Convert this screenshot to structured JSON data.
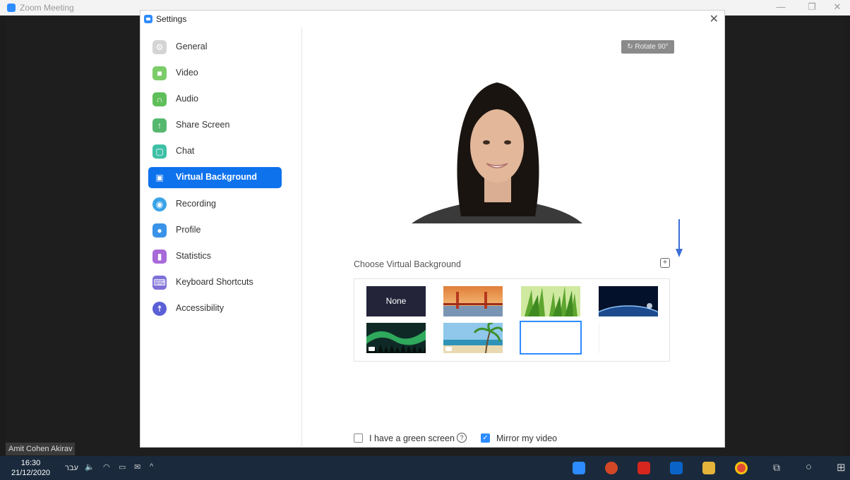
{
  "zoom_window": {
    "title": "Zoom Meeting",
    "participant_name": "Amit Cohen Akirav"
  },
  "settings": {
    "title": "Settings",
    "nav": [
      {
        "label": "General",
        "icon": "gear-icon",
        "color": "#d0d0d0"
      },
      {
        "label": "Video",
        "icon": "video-icon",
        "color": "#7ccc6a"
      },
      {
        "label": "Audio",
        "icon": "headphones-icon",
        "color": "#5fbf5a"
      },
      {
        "label": "Share Screen",
        "icon": "share-screen-icon",
        "color": "#55b86e"
      },
      {
        "label": "Chat",
        "icon": "chat-icon",
        "color": "#3ec0a6"
      },
      {
        "label": "Virtual Background",
        "icon": "person-card-icon",
        "color": "#0e72ed",
        "active": true
      },
      {
        "label": "Recording",
        "icon": "record-icon",
        "color": "#3aa3e8"
      },
      {
        "label": "Profile",
        "icon": "profile-icon",
        "color": "#3a93e8"
      },
      {
        "label": "Statistics",
        "icon": "bar-chart-icon",
        "color": "#a869d9"
      },
      {
        "label": "Keyboard Shortcuts",
        "icon": "keyboard-icon",
        "color": "#7e71d8"
      },
      {
        "label": "Accessibility",
        "icon": "accessibility-icon",
        "color": "#5a5fd6"
      }
    ],
    "rotate_label": "Rotate 90°",
    "choose_label": "Choose Virtual Background",
    "add_symbol": "+",
    "backgrounds": [
      {
        "label": "None",
        "kind": "none"
      },
      {
        "kind": "golden-gate-bridge"
      },
      {
        "kind": "grass"
      },
      {
        "kind": "earth-from-space"
      },
      {
        "kind": "aurora",
        "video": true
      },
      {
        "kind": "beach-palm",
        "video": true
      },
      {
        "kind": "blank",
        "selected": true
      },
      {
        "kind": "empty-slot"
      }
    ],
    "green_screen_label": "I have a green screen",
    "green_screen_checked": false,
    "mirror_label": "Mirror my video",
    "mirror_checked": true,
    "help_symbol": "?"
  },
  "taskbar": {
    "time": "16:30",
    "date": "21/12/2020",
    "language": "עבר",
    "accent_color": "#2d8cff"
  }
}
